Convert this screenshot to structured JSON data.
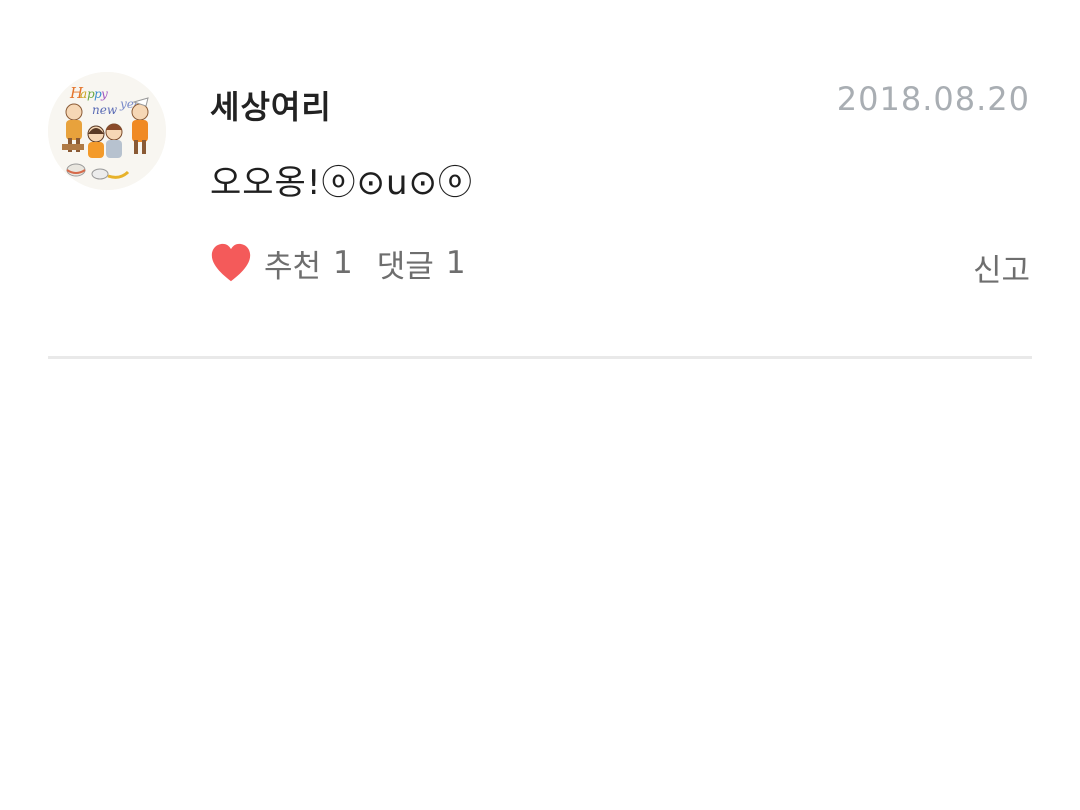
{
  "comment": {
    "author": "세상여리",
    "date": "2018.08.20",
    "text": "오오옹!ⓞ⊙u⊙ⓞ",
    "avatar_caption": "Happy new year",
    "likes_label": "추천",
    "likes_count": "1",
    "replies_label": "댓글",
    "replies_count": "1",
    "report_label": "신고"
  },
  "icons": {
    "like": "heart-icon"
  },
  "colors": {
    "heart": "#f45a5a",
    "date": "#a9aeb3",
    "author": "#222222",
    "meta": "#6e6e6e",
    "divider": "#e9e9e9"
  }
}
